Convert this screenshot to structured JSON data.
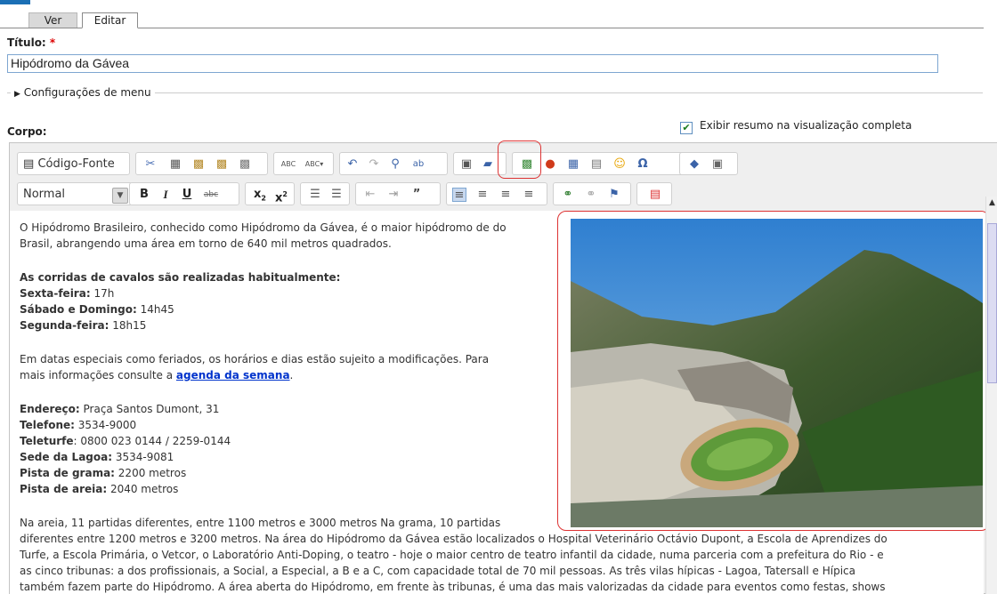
{
  "tabs": {
    "view": "Ver",
    "edit": "Editar"
  },
  "title_field": {
    "label": "Título:",
    "required_mark": "*",
    "value": "Hipódromo da Gávea"
  },
  "menu_settings": {
    "label": "Configurações de menu"
  },
  "body_field": {
    "label": "Corpo:",
    "summary_label": "Exibir resumo na visualização completa",
    "summary_checked": true
  },
  "toolbar": {
    "source_label": "Código-Fonte",
    "format_value": "Normal"
  },
  "content": {
    "p1_l1": "O Hipódromo Brasileiro, conhecido como Hipódromo da Gávea, é o maior hipódromo de  do",
    "p1_l2": "Brasil, abrangendo uma área em torno de 640 mil metros quadrados.",
    "races_heading": "As corridas de cavalos são realizadas habitualmente:",
    "fri_label": "Sexta-feira:",
    "fri_value": " 17h",
    "sat_label": "Sábado e Domingo:",
    "sat_value": " 14h45",
    "mon_label": "Segunda-feira:",
    "mon_value": " 18h15",
    "p3_l1": "Em datas especiais como feriados, os horários e dias estão sujeito a modificações. Para",
    "p3_l2a": "mais informações consulte a ",
    "p3_link": "agenda da semana",
    "p3_l2b": ".",
    "addr_label": "Endereço:",
    "addr_value": " Praça Santos Dumont, 31",
    "phone_label": "Telefone:",
    "phone_value": " 3534-9000",
    "teleturfe_label": "Teleturfe",
    "teleturfe_value": ": 0800 023 0144 / 2259-0144",
    "lagoa_label": "Sede da Lagoa:",
    "lagoa_value": " 3534-9081",
    "grass_label": "Pista de grama:",
    "grass_value": " 2200 metros",
    "sand_label": "Pista de areia:",
    "sand_value": " 2040 metros",
    "p4_l1": "Na areia, 11 partidas diferentes, entre 1100 metros  e 3000 metros Na grama, 10 partidas",
    "p4_l2": "diferentes  entre 1200 metros e 3200 metros. Na área do Hipódromo da Gávea estão localizados o Hospital Veterinário Octávio Dupont, a Escola de Aprendizes do",
    "p4_l3": "Turfe, a Escola Primária, o Vetcor, o Laboratório Anti-Doping, o teatro - hoje o maior centro de teatro infantil da cidade, numa parceria com a prefeitura do Rio - e",
    "p4_l4": "as cinco tribunas: a dos profissionais, a Social, a Especial, a B e a C, com capacidade total de 70 mil pessoas. As três vilas hípicas - Lagoa, Tatersall e Hípica",
    "p4_l5": "também fazem parte do Hipódromo. A área aberta do Hipódromo, em frente às tribunas, é uma das mais valorizadas da cidade para eventos como festas, shows"
  },
  "colors": {
    "accent": "#1b6fb5",
    "highlight": "#dd3333",
    "link": "#0033cc"
  }
}
